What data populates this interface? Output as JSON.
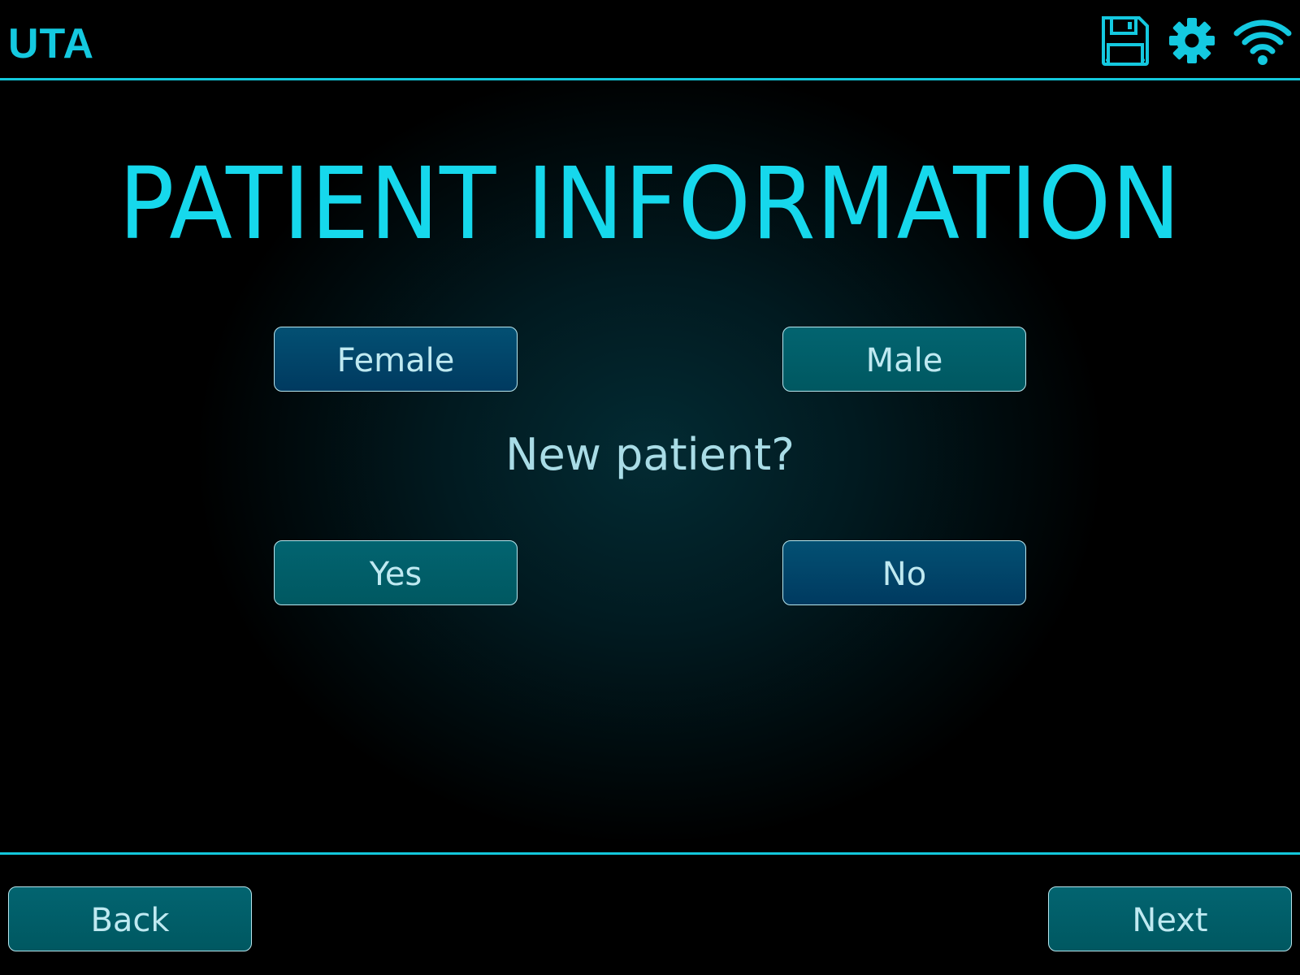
{
  "header": {
    "app_title": "UTA",
    "icons": [
      "save-icon",
      "gear-icon",
      "wifi-icon"
    ],
    "accent_color": "#13c8dc"
  },
  "main": {
    "title": "PATIENT INFORMATION",
    "gender": {
      "female_label": "Female",
      "male_label": "Male"
    },
    "new_patient": {
      "question": "New patient?",
      "yes_label": "Yes",
      "no_label": "No"
    }
  },
  "footer": {
    "back_label": "Back",
    "next_label": "Next"
  },
  "colors": {
    "title": "#16d8ec",
    "button_blue": "#004268",
    "button_teal": "#005f69",
    "button_text": "#bfe9f1"
  }
}
